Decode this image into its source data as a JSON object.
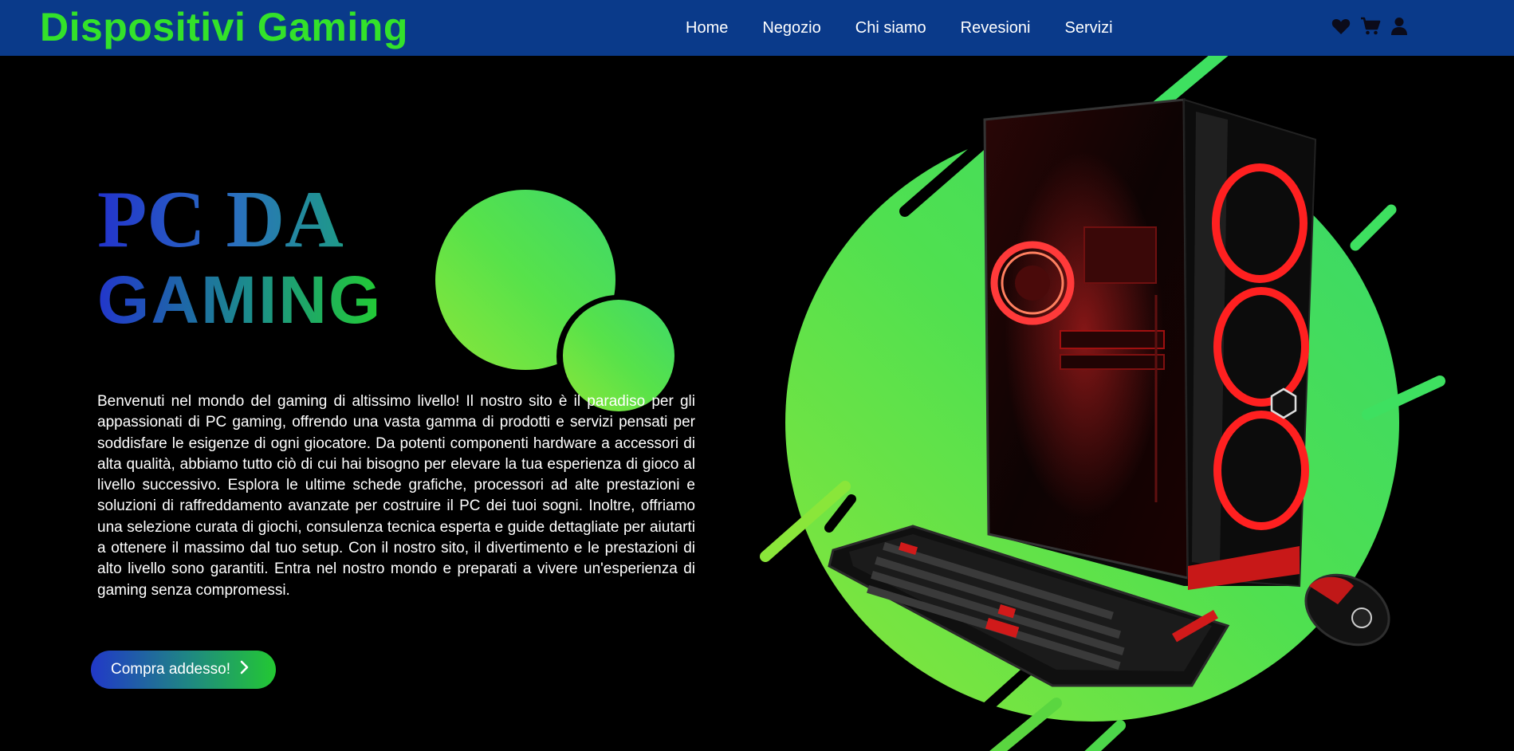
{
  "header": {
    "brand": "Dispositivi Gaming",
    "nav": [
      "Home",
      "Negozio",
      "Chi siamo",
      "Revesioni",
      "Servizi"
    ],
    "icons": [
      "heart-icon",
      "cart-icon",
      "user-icon"
    ]
  },
  "hero": {
    "title_line1": "PC DA",
    "title_line2": "GAMING",
    "intro": "Benvenuti nel mondo del gaming di altissimo livello! Il nostro sito è il paradiso per gli appassionati di PC gaming, offrendo una vasta gamma di prodotti e servizi pensati per soddisfare le esigenze di ogni giocatore. Da potenti componenti hardware a accessori di alta qualità, abbiamo tutto ciò di cui hai bisogno per elevare la tua esperienza di gioco al livello successivo. Esplora le ultime schede grafiche, processori ad alte prestazioni e soluzioni di raffreddamento avanzate per costruire il PC dei tuoi sogni. Inoltre, offriamo una selezione curata di giochi, consulenza tecnica esperta e guide dettagliate per aiutarti a ottenere il massimo dal tuo setup. Con il nostro sito, il divertimento e le prestazioni di alto livello sono garantiti. Entra nel nostro mondo e preparati a vivere un'esperienza di gaming senza compromessi.",
    "cta_label": "Compra addesso!"
  },
  "colors": {
    "header_bg": "#0a3a8a",
    "brand": "#33e22a",
    "accent_green": "#4be04a",
    "accent_blue": "#2236cc",
    "page_bg": "#000000"
  }
}
